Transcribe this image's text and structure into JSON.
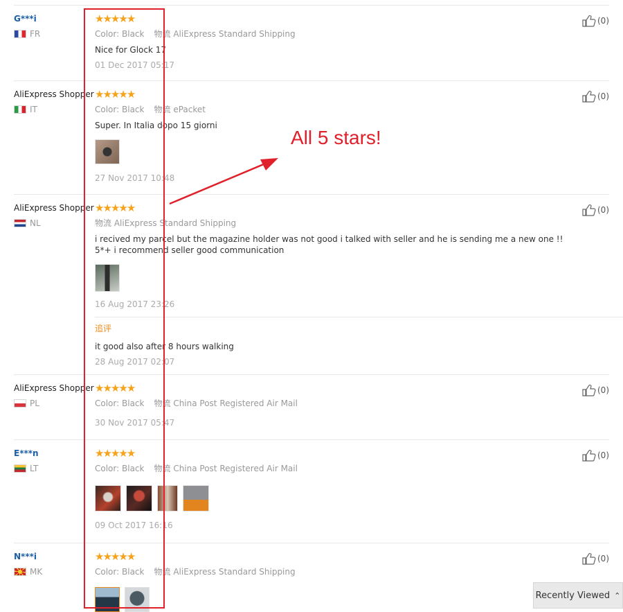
{
  "reviews": [
    {
      "user": "G***i",
      "user_style": "link",
      "country": "FR",
      "flag": "fr",
      "color_label": "Color:",
      "color_value": "Black",
      "ship_label": "物流",
      "ship_value": "AliExpress Standard Shipping",
      "text": "Nice for Glock 17",
      "date": "01 Dec 2017 05:17",
      "helpful": "(0)"
    },
    {
      "user": "AliExpress Shopper",
      "user_style": "plain",
      "country": "IT",
      "flag": "it",
      "color_label": "Color:",
      "color_value": "Black",
      "ship_label": "物流",
      "ship_value": "ePacket",
      "text": "Super. In Italia dopo 15 giorni",
      "date": "27 Nov 2017 10:48",
      "helpful": "(0)"
    },
    {
      "user": "AliExpress Shopper",
      "user_style": "plain",
      "country": "NL",
      "flag": "nl",
      "ship_label": "物流",
      "ship_value": "AliExpress Standard Shipping",
      "text": "i recived my parcel but the magazine holder was not good i talked with seller and he is sending me a new one !! 5*+ i recommend seller good communication",
      "date": "16 Aug 2017 23:26",
      "followup_label": "追评",
      "followup_text": "it good also after 8 hours walking",
      "followup_date": "28 Aug 2017 02:07",
      "helpful": "(0)"
    },
    {
      "user": "AliExpress Shopper",
      "user_style": "plain",
      "country": "PL",
      "flag": "pl",
      "color_label": "Color:",
      "color_value": "Black",
      "ship_label": "物流",
      "ship_value": "China Post Registered Air Mail",
      "date": "30 Nov 2017 05:47",
      "helpful": "(0)"
    },
    {
      "user": "E***n",
      "user_style": "link",
      "country": "LT",
      "flag": "lt",
      "color_label": "Color:",
      "color_value": "Black",
      "ship_label": "物流",
      "ship_value": "China Post Registered Air Mail",
      "date": "09 Oct 2017 16:16",
      "helpful": "(0)"
    },
    {
      "user": "N***i",
      "user_style": "link",
      "country": "MK",
      "flag": "mk",
      "color_label": "Color:",
      "color_value": "Black",
      "ship_label": "物流",
      "ship_value": "AliExpress Standard Shipping",
      "helpful": "(0)"
    }
  ],
  "rating": {
    "stars": 5,
    "max": 5
  },
  "annotation": "All 5 stars!",
  "recently_viewed": "Recently Viewed",
  "colors": {
    "star": "#f6a21a",
    "annotation": "#e0202a",
    "link": "#1b5ea8",
    "followup": "#f08c1c"
  }
}
